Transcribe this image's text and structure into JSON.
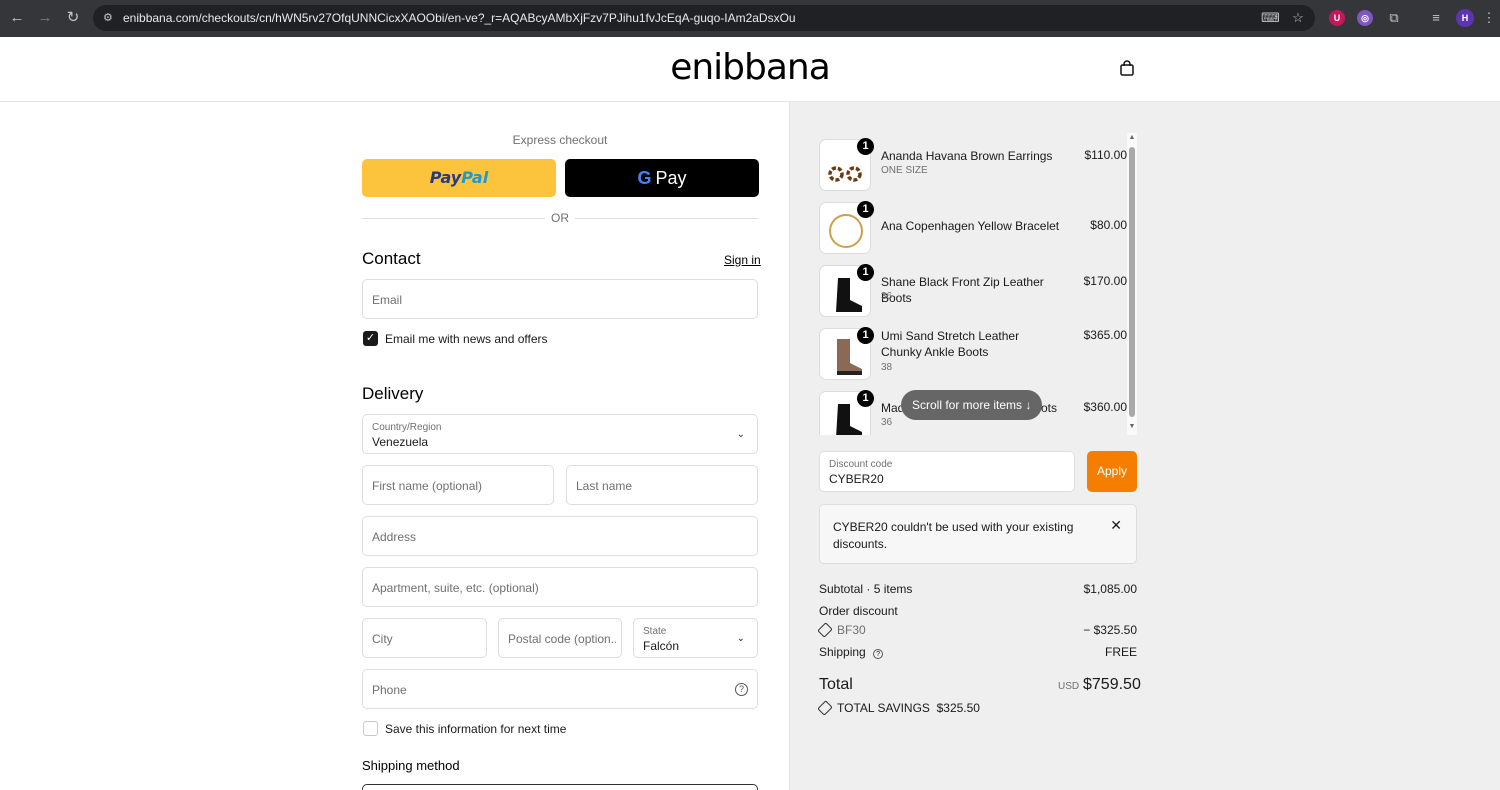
{
  "browser": {
    "url": "enibbana.com/checkouts/cn/hWN5rv27OfqUNNCicxXAOObi/en-ve?_r=AQABcyAMbXjFzv7PJihu1fvJcEqA-guqo-IAm2aDsxOu"
  },
  "header": {
    "logo": "enibbana"
  },
  "express": {
    "title": "Express checkout",
    "paypal_a": "Pay",
    "paypal_b": "Pal",
    "gpay_g": "G",
    "gpay_label": "Pay",
    "or": "OR"
  },
  "contact": {
    "title": "Contact",
    "signin": "Sign in",
    "email_placeholder": "Email",
    "newsletter_label": "Email me with news and offers"
  },
  "delivery": {
    "title": "Delivery",
    "country_label": "Country/Region",
    "country_value": "Venezuela",
    "first_name": "First name (optional)",
    "last_name": "Last name",
    "address": "Address",
    "apartment": "Apartment, suite, etc. (optional)",
    "city": "City",
    "postal": "Postal code (option...",
    "state_label": "State",
    "state_value": "Falcón",
    "phone": "Phone",
    "save_label": "Save this information for next time"
  },
  "shipping": {
    "title": "Shipping method"
  },
  "cart": {
    "items": [
      {
        "qty": "1",
        "name": "Ananda Havana Brown Earrings",
        "variant": "ONE SIZE",
        "price": "$110.00"
      },
      {
        "qty": "1",
        "name": "Ana Copenhagen Yellow Bracelet",
        "variant": "",
        "price": "$80.00"
      },
      {
        "qty": "1",
        "name": "Shane Black Front Zip Leather Boots",
        "variant": "36",
        "price": "$170.00"
      },
      {
        "qty": "1",
        "name": "Umi Sand Stretch Leather Chunky Ankle Boots",
        "variant": "38",
        "price": "$365.00"
      },
      {
        "qty": "1",
        "name": "Mad",
        "name_end": "ots",
        "variant": "36",
        "price": "$360.00"
      }
    ],
    "scroll_hint": "Scroll for more items ↓"
  },
  "discount": {
    "label": "Discount code",
    "value": "CYBER20",
    "apply": "Apply",
    "notice": "CYBER20 couldn't be used with your existing discounts."
  },
  "summary": {
    "subtotal_label": "Subtotal · 5 items",
    "subtotal": "$1,085.00",
    "order_discount_label": "Order discount",
    "code": "BF30",
    "code_amount": "− $325.50",
    "shipping_label": "Shipping",
    "shipping_value": "FREE",
    "total_label": "Total",
    "currency": "USD",
    "total": "$759.50",
    "savings_label": "TOTAL SAVINGS",
    "savings": "$325.50"
  }
}
